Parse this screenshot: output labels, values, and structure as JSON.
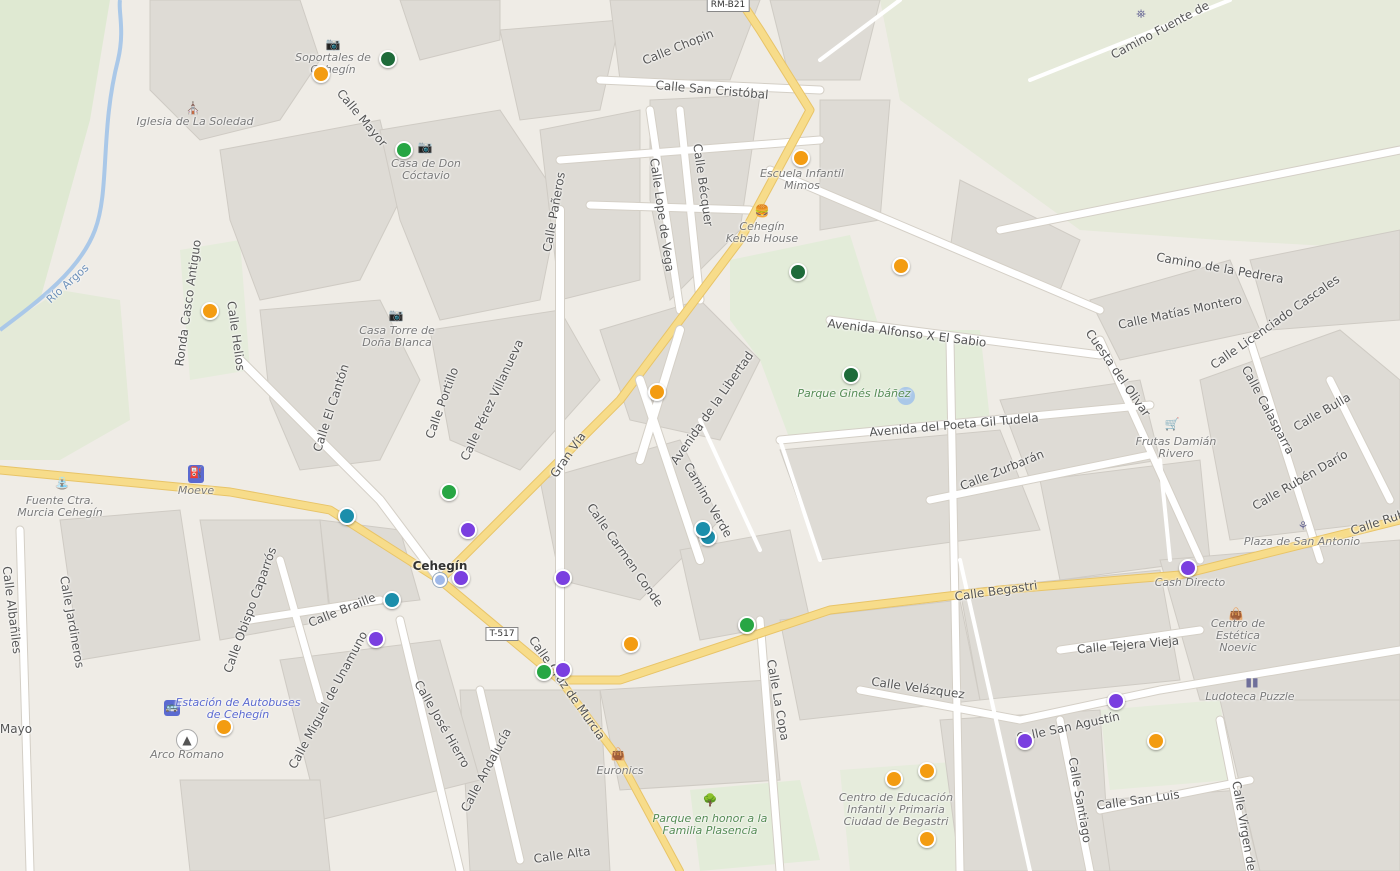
{
  "map": {
    "road_refs": [
      "RM-B21",
      "T-517"
    ],
    "town": "Cehegín",
    "streets": [
      "Calle Chopin",
      "Calle San Cristóbal",
      "Calle Lope de Vega",
      "Calle Bécquer",
      "Avenida Alfonso X El Sabio",
      "Avenida del Poeta Gil Tudela",
      "Avenida de la Libertad",
      "Camino Verde",
      "Calle Carmen Conde",
      "Gran Vía",
      "Calle Begastri",
      "Calle Velázquez",
      "Calle Zurbarán",
      "Calle Matías Montero",
      "Calle Licenciado Cascales",
      "Camino de la Pedrera",
      "Cuesta del Olivar",
      "Calle Tejera Vieja",
      "Calle San Agustín",
      "Calle San Luis",
      "Calle Santiago",
      "Calle La Copa",
      "Calle Braille",
      "Calle Obispo Caparrós",
      "Calle Jardineros",
      "Calle Albañiles",
      "Calle José Hierro",
      "Calle Miguel de Unamuno",
      "Ronda Casco Antiguo",
      "Calle Helios",
      "Calle El Cantón",
      "Calle Portillo",
      "Calle Pérez Villanueva",
      "Calle Pañeros",
      "Calle Mayor",
      "Calle Andalucía",
      "Calle Alta",
      "Calle Rubén Darío",
      "Calle Bulla",
      "Calle Calasparra",
      "Calle Virgen de",
      "Camino Fuente de",
      "Calle Rubén",
      "Calle Cruz de Murcia",
      "Mayo"
    ],
    "pois": [
      "Soportales de Cehegín",
      "Iglesia de La Soledad",
      "Casa de Don Cóctavio",
      "Casa Torre de Doña Blanca",
      "Escuela Infantil Mimos",
      "Cehegín Kebab House",
      "Parque Ginés Ibáñez",
      "Frutas Damián Rivero",
      "Plaza de San Antonio",
      "Cash Directo",
      "Centro de Estética Noevic",
      "Ludoteca Puzzle",
      "Fuente Ctra. Murcia Cehegín",
      "Moeve",
      "Estación de Autobuses de Cehegín",
      "Arco Romano",
      "Euronics",
      "Parque en honor a la Familia Plasencia",
      "Centro de Educación Infantil y Primaria Ciudad de Begastri"
    ],
    "river": "Río Argos",
    "marker_colors": {
      "orange": "#f39c12",
      "dark_green": "#1e6b3a",
      "green": "#27a644",
      "teal": "#1b8eab",
      "purple": "#7a3fe0"
    },
    "marker_counts": {
      "orange": 13,
      "dark_green": 3,
      "green": 5,
      "teal": 4,
      "purple": 9
    },
    "colors": {
      "background": "#f2efe9",
      "main_road": "#f7dc8a",
      "park": "#e3ecd9",
      "water": "#aac8e8"
    }
  }
}
